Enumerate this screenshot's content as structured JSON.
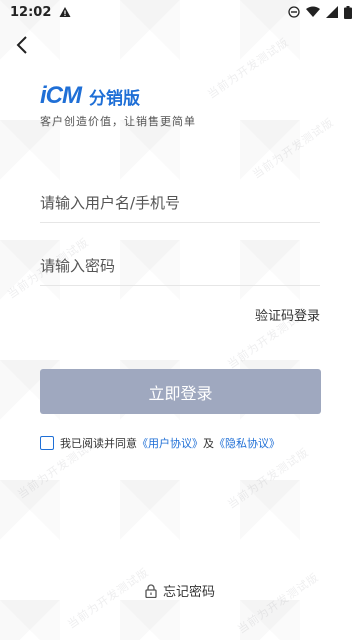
{
  "status_bar": {
    "time": "12:02",
    "alert_icon": "warning-triangle-icon",
    "right_icons": [
      "do-not-disturb-icon",
      "wifi-icon",
      "signal-icon",
      "battery-icon"
    ]
  },
  "header": {
    "back_icon": "chevron-left-icon"
  },
  "brand": {
    "logo_mark": "iCM",
    "logo_text": "分销版",
    "slogan": "客户创造价值，让销售更简单",
    "color": "#1f6fd6"
  },
  "form": {
    "username_placeholder": "请输入用户名/手机号",
    "password_placeholder": "请输入密码",
    "sms_login_label": "验证码登录",
    "login_button_label": "立即登录",
    "login_button_color": "#9fa8bf"
  },
  "agreement": {
    "prefix": "我已阅读并同意",
    "user_agreement": "《用户协议》",
    "and": "及",
    "privacy_policy": "《隐私协议》",
    "checked": false
  },
  "footer": {
    "forgot_password_label": "忘记密码"
  },
  "watermark": {
    "text": "当前为开发测试版"
  }
}
